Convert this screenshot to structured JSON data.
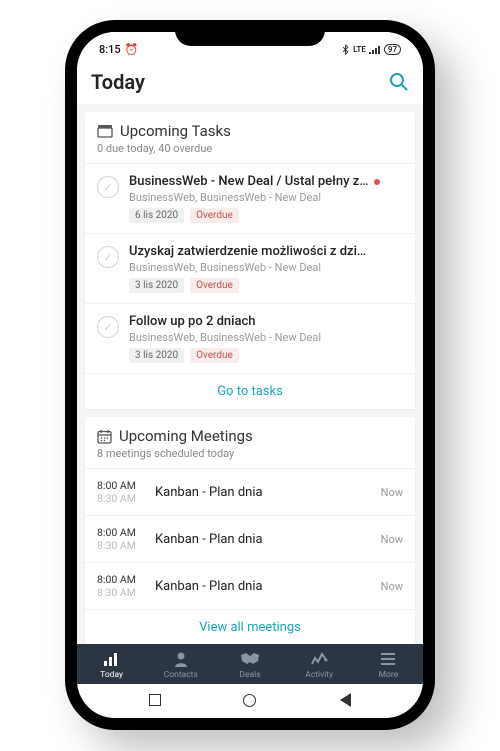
{
  "status": {
    "time": "8:15",
    "alarm_icon": "alarm",
    "bt": "bt",
    "net": "LTE",
    "battery": "97"
  },
  "header": {
    "title": "Today"
  },
  "tasks": {
    "section_title": "Upcoming Tasks",
    "section_subtitle": "0 due today, 40 overdue",
    "items": [
      {
        "title": "BusinessWeb - New Deal / Ustal pełny z…",
        "sub": "BusinessWeb, BusinessWeb - New Deal",
        "date": "6 lis 2020",
        "status": "Overdue",
        "flag": true
      },
      {
        "title": "Uzyskaj zatwierdzenie możliwości z dzi…",
        "sub": "BusinessWeb, BusinessWeb - New Deal",
        "date": "3 lis 2020",
        "status": "Overdue",
        "flag": false
      },
      {
        "title": "Follow up po 2 dniach",
        "sub": "BusinessWeb, BusinessWeb - New Deal",
        "date": "3 lis 2020",
        "status": "Overdue",
        "flag": false
      }
    ],
    "footer": "Go to tasks"
  },
  "meetings": {
    "section_title": "Upcoming Meetings",
    "section_subtitle": "8 meetings scheduled today",
    "items": [
      {
        "start": "8:00 AM",
        "end": "8:30 AM",
        "title": "Kanban - Plan dnia",
        "badge": "Now"
      },
      {
        "start": "8:00 AM",
        "end": "8:30 AM",
        "title": "Kanban - Plan dnia",
        "badge": "Now"
      },
      {
        "start": "8:00 AM",
        "end": "8:30 AM",
        "title": "Kanban - Plan dnia",
        "badge": "Now"
      }
    ],
    "footer": "View all meetings"
  },
  "nav": {
    "items": [
      {
        "label": "Today",
        "icon": "bars"
      },
      {
        "label": "Contacts",
        "icon": "person"
      },
      {
        "label": "Deals",
        "icon": "handshake"
      },
      {
        "label": "Activity",
        "icon": "activity"
      },
      {
        "label": "More",
        "icon": "menu"
      }
    ]
  }
}
